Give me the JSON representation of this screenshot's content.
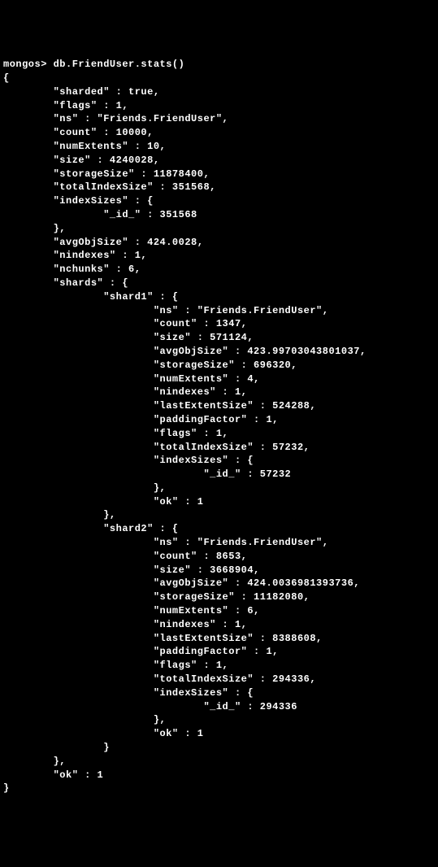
{
  "prompt": "mongos>",
  "command": "db.FriendUser.stats()",
  "lines": [
    "mongos> db.FriendUser.stats()",
    "{",
    "        \"sharded\" : true,",
    "        \"flags\" : 1,",
    "        \"ns\" : \"Friends.FriendUser\",",
    "        \"count\" : 10000,",
    "        \"numExtents\" : 10,",
    "        \"size\" : 4240028,",
    "        \"storageSize\" : 11878400,",
    "        \"totalIndexSize\" : 351568,",
    "        \"indexSizes\" : {",
    "                \"_id_\" : 351568",
    "        },",
    "        \"avgObjSize\" : 424.0028,",
    "        \"nindexes\" : 1,",
    "        \"nchunks\" : 6,",
    "        \"shards\" : {",
    "                \"shard1\" : {",
    "                        \"ns\" : \"Friends.FriendUser\",",
    "                        \"count\" : 1347,",
    "                        \"size\" : 571124,",
    "                        \"avgObjSize\" : 423.99703043801037,",
    "                        \"storageSize\" : 696320,",
    "                        \"numExtents\" : 4,",
    "                        \"nindexes\" : 1,",
    "                        \"lastExtentSize\" : 524288,",
    "                        \"paddingFactor\" : 1,",
    "                        \"flags\" : 1,",
    "                        \"totalIndexSize\" : 57232,",
    "                        \"indexSizes\" : {",
    "                                \"_id_\" : 57232",
    "                        },",
    "                        \"ok\" : 1",
    "                },",
    "                \"shard2\" : {",
    "                        \"ns\" : \"Friends.FriendUser\",",
    "                        \"count\" : 8653,",
    "                        \"size\" : 3668904,",
    "                        \"avgObjSize\" : 424.0036981393736,",
    "                        \"storageSize\" : 11182080,",
    "                        \"numExtents\" : 6,",
    "                        \"nindexes\" : 1,",
    "                        \"lastExtentSize\" : 8388608,",
    "                        \"paddingFactor\" : 1,",
    "                        \"flags\" : 1,",
    "                        \"totalIndexSize\" : 294336,",
    "                        \"indexSizes\" : {",
    "                                \"_id_\" : 294336",
    "                        },",
    "                        \"ok\" : 1",
    "                }",
    "        },",
    "        \"ok\" : 1",
    "}"
  ]
}
